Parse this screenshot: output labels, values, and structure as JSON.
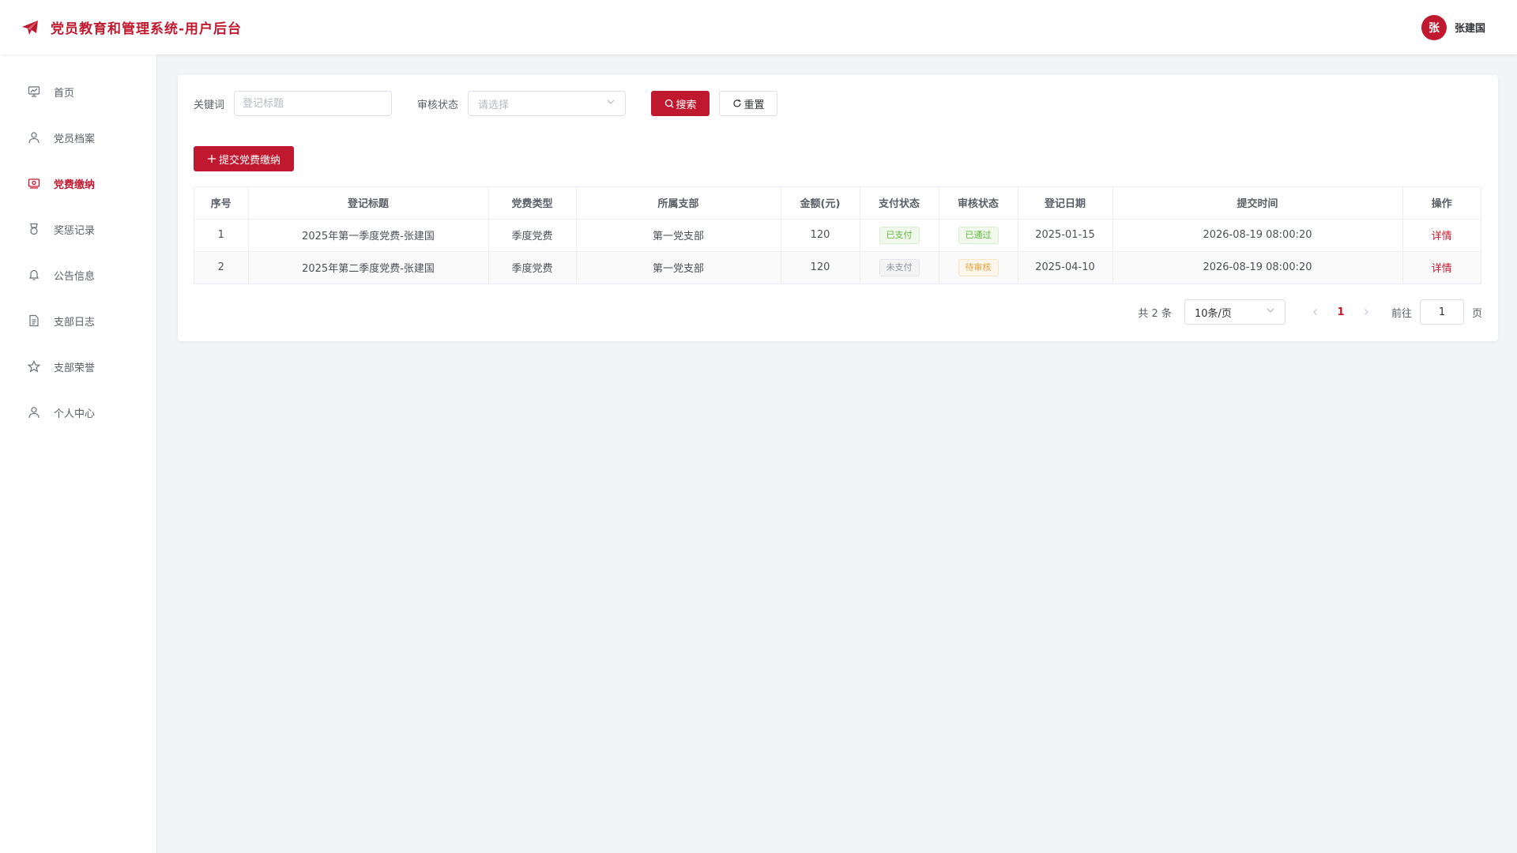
{
  "header": {
    "title": "党员教育和管理系统-用户后台",
    "user": {
      "avatar_text": "张",
      "name": "张建国"
    }
  },
  "sidebar": {
    "items": [
      {
        "label": "首页",
        "icon": "dashboard-icon"
      },
      {
        "label": "党员档案",
        "icon": "user-icon"
      },
      {
        "label": "党费缴纳",
        "icon": "money-icon",
        "active": true
      },
      {
        "label": "奖惩记录",
        "icon": "medal-icon"
      },
      {
        "label": "公告信息",
        "icon": "bell-icon"
      },
      {
        "label": "支部日志",
        "icon": "document-icon"
      },
      {
        "label": "支部荣誉",
        "icon": "star-icon"
      },
      {
        "label": "个人中心",
        "icon": "user-icon"
      }
    ]
  },
  "search": {
    "keyword_label": "关键词",
    "keyword_placeholder": "登记标题",
    "status_label": "审核状态",
    "status_placeholder": "请选择",
    "search_button": "搜索",
    "reset_button": "重置"
  },
  "toolbar": {
    "add_button": "提交党费缴纳"
  },
  "table": {
    "columns": [
      "序号",
      "登记标题",
      "党费类型",
      "所属支部",
      "金额(元)",
      "支付状态",
      "审核状态",
      "登记日期",
      "提交时间",
      "操作"
    ],
    "rows": [
      {
        "index": "1",
        "title": "2025年第一季度党费-张建国",
        "type": "季度党费",
        "branch": "第一党支部",
        "amount": "120",
        "pay_status": "已支付",
        "review_status": "已通过",
        "date": "2025-01-15",
        "submitted": "2026-08-19 08:00:20",
        "action": "详情"
      },
      {
        "index": "2",
        "title": "2025年第二季度党费-张建国",
        "type": "季度党费",
        "branch": "第一党支部",
        "amount": "120",
        "pay_status": "未支付",
        "review_status": "待审核",
        "date": "2025-04-10",
        "submitted": "2026-08-19 08:00:20",
        "action": "详情"
      }
    ]
  },
  "pagination": {
    "total": "共 2 条",
    "page_size": "10条/页",
    "current_page": "1",
    "goto_label": "前往",
    "goto_value": "1",
    "goto_suffix": "页"
  },
  "colors": {
    "primary": "#c0192f",
    "success": "#5fb83c",
    "warning": "#e6a23c",
    "info": "#8c8f96"
  }
}
